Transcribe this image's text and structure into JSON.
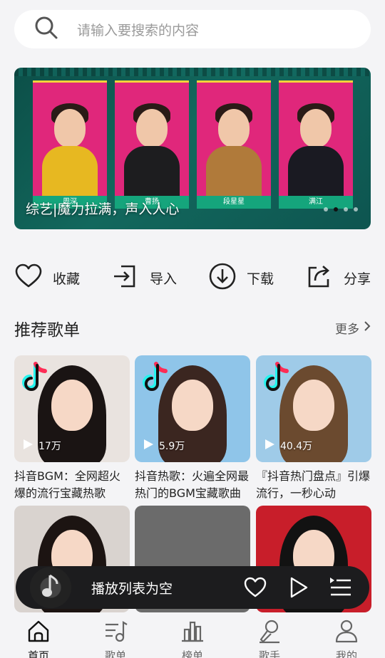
{
  "search": {
    "placeholder": "请输入要搜索的内容"
  },
  "banner": {
    "caption": "综艺|魔力拉满，声入人心",
    "cards": [
      {
        "tag": "周深",
        "body_color": "#e7b821"
      },
      {
        "tag": "曹扬",
        "body_color": "#1d1d1f"
      },
      {
        "tag": "段星星",
        "body_color": "#b07a3a"
      },
      {
        "tag": "满江",
        "body_color": "#1a1a22"
      }
    ],
    "dots": 4,
    "active_dot": 1
  },
  "actions": [
    {
      "label": "收藏",
      "icon": "heart-icon"
    },
    {
      "label": "导入",
      "icon": "import-icon"
    },
    {
      "label": "下载",
      "icon": "download-icon"
    },
    {
      "label": "分享",
      "icon": "share-icon"
    }
  ],
  "recommend": {
    "title": "推荐歌单",
    "more": "更多",
    "playlists": [
      {
        "name": "抖音BGM：全网超火爆的流行宝藏热歌",
        "plays": "17万",
        "bg": "#e9e3df",
        "hair": "#1a1413"
      },
      {
        "name": "抖音热歌：火遍全网最热门的BGM宝藏歌曲",
        "plays": "5.9万",
        "bg": "#8fc5e9",
        "hair": "#3b2620"
      },
      {
        "name": "『抖音热门盘点』引爆流行，一秒心动",
        "plays": "40.4万",
        "bg": "#9fcbe8",
        "hair": "#6b4a2f"
      },
      {
        "name": "",
        "plays": "",
        "bg": "#d9d3cf",
        "hair": "#1c1412"
      },
      {
        "name": "",
        "plays": "",
        "bg": "#6b6b6b",
        "hair": "#6b6b6b"
      },
      {
        "name": "",
        "plays": "",
        "bg": "#c81e2a",
        "hair": "#121212"
      }
    ]
  },
  "player": {
    "text": "播放列表为空"
  },
  "tabs": [
    {
      "label": "首页",
      "icon": "home-icon",
      "active": true
    },
    {
      "label": "歌单",
      "icon": "playlist-icon",
      "active": false
    },
    {
      "label": "榜单",
      "icon": "chart-icon",
      "active": false
    },
    {
      "label": "歌手",
      "icon": "singer-icon",
      "active": false
    },
    {
      "label": "我的",
      "icon": "profile-icon",
      "active": false
    }
  ]
}
